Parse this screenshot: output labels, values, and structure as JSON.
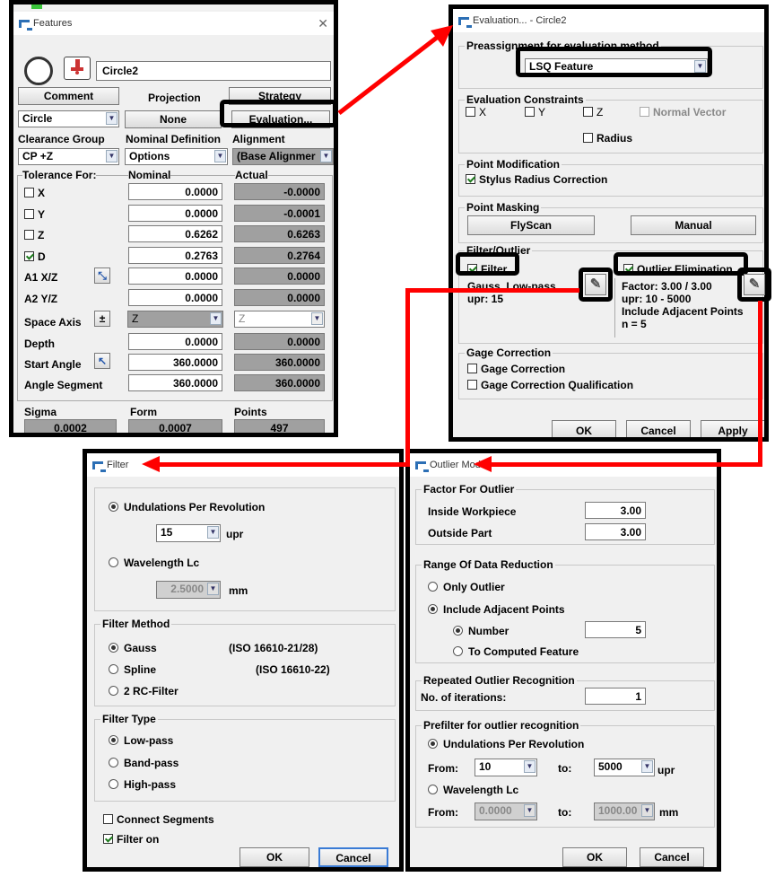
{
  "features": {
    "title": "Features",
    "name_value": "Circle2",
    "buttons": {
      "comment": "Comment",
      "strategy": "Strategy",
      "projection": "Projection",
      "projection_value": "None",
      "evaluation": "Evaluation..."
    },
    "type_value": "Circle",
    "headers": {
      "clearance": "Clearance Group",
      "nominal_def": "Nominal Definition",
      "alignment": "Alignment"
    },
    "clearance_value": "CP +Z",
    "options_value": "Options",
    "alignment_value": "(Base Alignmer",
    "cols": {
      "tolerance_for": "Tolerance For:",
      "nominal": "Nominal",
      "actual": "Actual"
    },
    "rows": [
      {
        "label": "X",
        "nominal": "0.0000",
        "actual": "-0.0000"
      },
      {
        "label": "Y",
        "nominal": "0.0000",
        "actual": "-0.0001"
      },
      {
        "label": "Z",
        "nominal": "0.6262",
        "actual": "0.6263"
      },
      {
        "label": "D",
        "nominal": "0.2763",
        "actual": "0.2764"
      },
      {
        "label": "A1 X/Z",
        "nominal": "0.0000",
        "actual": "0.0000"
      },
      {
        "label": "A2 Y/Z",
        "nominal": "0.0000",
        "actual": "0.0000"
      }
    ],
    "space_axis": {
      "label": "Space Axis",
      "sign": "±",
      "value": "Z",
      "actual": "Z"
    },
    "depth": {
      "label": "Depth",
      "nominal": "0.0000",
      "actual": "0.0000"
    },
    "start_angle": {
      "label": "Start Angle",
      "nominal": "360.0000",
      "actual": "360.0000"
    },
    "angle_segment": {
      "label": "Angle Segment",
      "nominal": "360.0000",
      "actual": "360.0000"
    },
    "stats": {
      "sigma": "Sigma",
      "form": "Form",
      "points": "Points",
      "sigma_v": "0.0002",
      "form_v": "0.0007",
      "points_v": "497"
    }
  },
  "evaluation": {
    "title": "Evaluation... - Circle2",
    "preassign_label": "Preassignment for evaluation method",
    "method_value": "LSQ Feature",
    "constraints_label": "Evaluation Constraints",
    "cx": "X",
    "cy": "Y",
    "cz": "Z",
    "normal_vector": "Normal Vector",
    "radius": "Radius",
    "point_mod_label": "Point Modification",
    "stylus": "Stylus Radius Correction",
    "masking_label": "Point Masking",
    "flyscan": "FlyScan",
    "manual": "Manual",
    "filter_outlier_label": "Filter/Outlier",
    "filter": "Filter",
    "filter_desc1": "Gauss, Low-pass",
    "filter_desc2": "upr: 15",
    "outlier": "Outlier Elimination",
    "out_desc1": "Factor: 3.00 / 3.00",
    "out_desc2": "upr: 10 - 5000",
    "out_desc3": "Include Adjacent Points",
    "out_desc4": "n = 5",
    "gage_label": "Gage Correction",
    "gage1": "Gage Correction",
    "gage2": "Gage Correction Qualification",
    "ok": "OK",
    "cancel": "Cancel",
    "apply": "Apply"
  },
  "filter_dlg": {
    "title": "Filter",
    "upr_label": "Undulations Per Revolution",
    "upr_value": "15",
    "upr_unit": "upr",
    "wl_label": "Wavelength Lc",
    "wl_value": "2.5000",
    "wl_unit": "mm",
    "method_label": "Filter Method",
    "gauss": "Gauss",
    "gauss_iso": "(ISO 16610-21/28)",
    "spline": "Spline",
    "spline_iso": "(ISO 16610-22)",
    "rc": "2 RC-Filter",
    "type_label": "Filter Type",
    "low": "Low-pass",
    "band": "Band-pass",
    "high": "High-pass",
    "connect": "Connect Segments",
    "filter_on": "Filter on",
    "ok": "OK",
    "cancel": "Cancel"
  },
  "outlier_dlg": {
    "title": "Outlier Mode",
    "factor_label": "Factor For Outlier",
    "inside": "Inside Workpiece",
    "inside_v": "3.00",
    "outside": "Outside Part",
    "outside_v": "3.00",
    "range_label": "Range Of Data Reduction",
    "only": "Only Outlier",
    "adjacent": "Include Adjacent Points",
    "number": "Number",
    "number_v": "5",
    "computed": "To Computed Feature",
    "repeated_label": "Repeated Outlier Recognition",
    "iter": "No. of iterations:",
    "iter_v": "1",
    "prefilter_label": "Prefilter for outlier recognition",
    "upr": "Undulations Per Revolution",
    "from": "From:",
    "to": "to:",
    "from_v": "10",
    "to_v": "5000",
    "upr_unit": "upr",
    "wl": "Wavelength Lc",
    "from2_v": "0.0000",
    "to2_v": "1000.00",
    "mm": "mm",
    "ok": "OK",
    "cancel": "Cancel"
  }
}
